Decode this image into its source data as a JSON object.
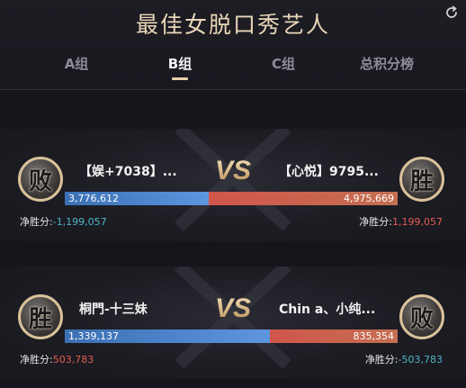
{
  "page": {
    "title": "最佳女脱口秀艺人",
    "refresh_icon": "refresh-icon"
  },
  "tabs": [
    {
      "label": "A组",
      "active": false
    },
    {
      "label": "B组",
      "active": true
    },
    {
      "label": "C组",
      "active": false
    },
    {
      "label": "总积分榜",
      "active": false
    }
  ],
  "colors": {
    "accent": "#e6d0ac",
    "blue_bar": "#4a82cc",
    "red_bar": "#cc5b4c",
    "negative": "#4fb6c8",
    "positive": "#e25d4f"
  },
  "matches": [
    {
      "vs": "VS",
      "left": {
        "name": "【娱+7038】...",
        "badge": "败",
        "votes": "3,776,612",
        "vote_count": 3776612,
        "net_label": "净胜分:",
        "net_value": "-1,199,057"
      },
      "right": {
        "name": "【心悦】9795...",
        "badge": "胜",
        "votes": "4,975,669",
        "vote_count": 4975669,
        "net_label": "净胜分:",
        "net_value": "1,199,057"
      }
    },
    {
      "vs": "VS",
      "left": {
        "name": "桐門-十三妹",
        "badge": "胜",
        "votes": "1,339,137",
        "vote_count": 1339137,
        "net_label": "净胜分:",
        "net_value": "503,783"
      },
      "right": {
        "name": "Chin a、小纯...",
        "badge": "败",
        "votes": "835,354",
        "vote_count": 835354,
        "net_label": "净胜分:",
        "net_value": "-503,783"
      }
    }
  ]
}
